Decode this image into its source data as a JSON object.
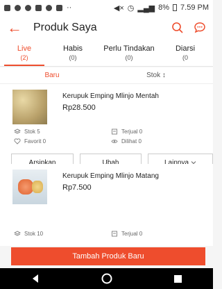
{
  "status_bar": {
    "battery": "8%",
    "time": "7.59 PM"
  },
  "header": {
    "title": "Produk Saya",
    "back_icon": "arrow-left-icon",
    "search_icon": "search-icon",
    "chat_icon": "chat-icon"
  },
  "tabs": [
    {
      "label": "Live",
      "count": "(2)",
      "active": true
    },
    {
      "label": "Habis",
      "count": "(0)"
    },
    {
      "label": "Perlu Tindakan",
      "count": "(0)"
    },
    {
      "label": "Diarsi",
      "count": "(0"
    }
  ],
  "sort": {
    "new_label": "Baru",
    "stock_label": "Stok ↕"
  },
  "products": [
    {
      "name": "Kerupuk Emping Mlinjo Mentah",
      "price": "Rp28.500",
      "stock": "Stok 5",
      "sold": "Terjual 0",
      "favorite": "Favorit 0",
      "viewed": "Dilihat 0"
    },
    {
      "name": "Kerupuk Emping Mlinjo Matang",
      "price": "Rp7.500",
      "stock": "Stok 10",
      "sold": "Terjual 0"
    }
  ],
  "actions": {
    "archive": "Arsipkan",
    "edit": "Ubah",
    "more": "Lainnya"
  },
  "add_button": "Tambah Produk Baru",
  "colors": {
    "accent": "#ee4d2d"
  }
}
